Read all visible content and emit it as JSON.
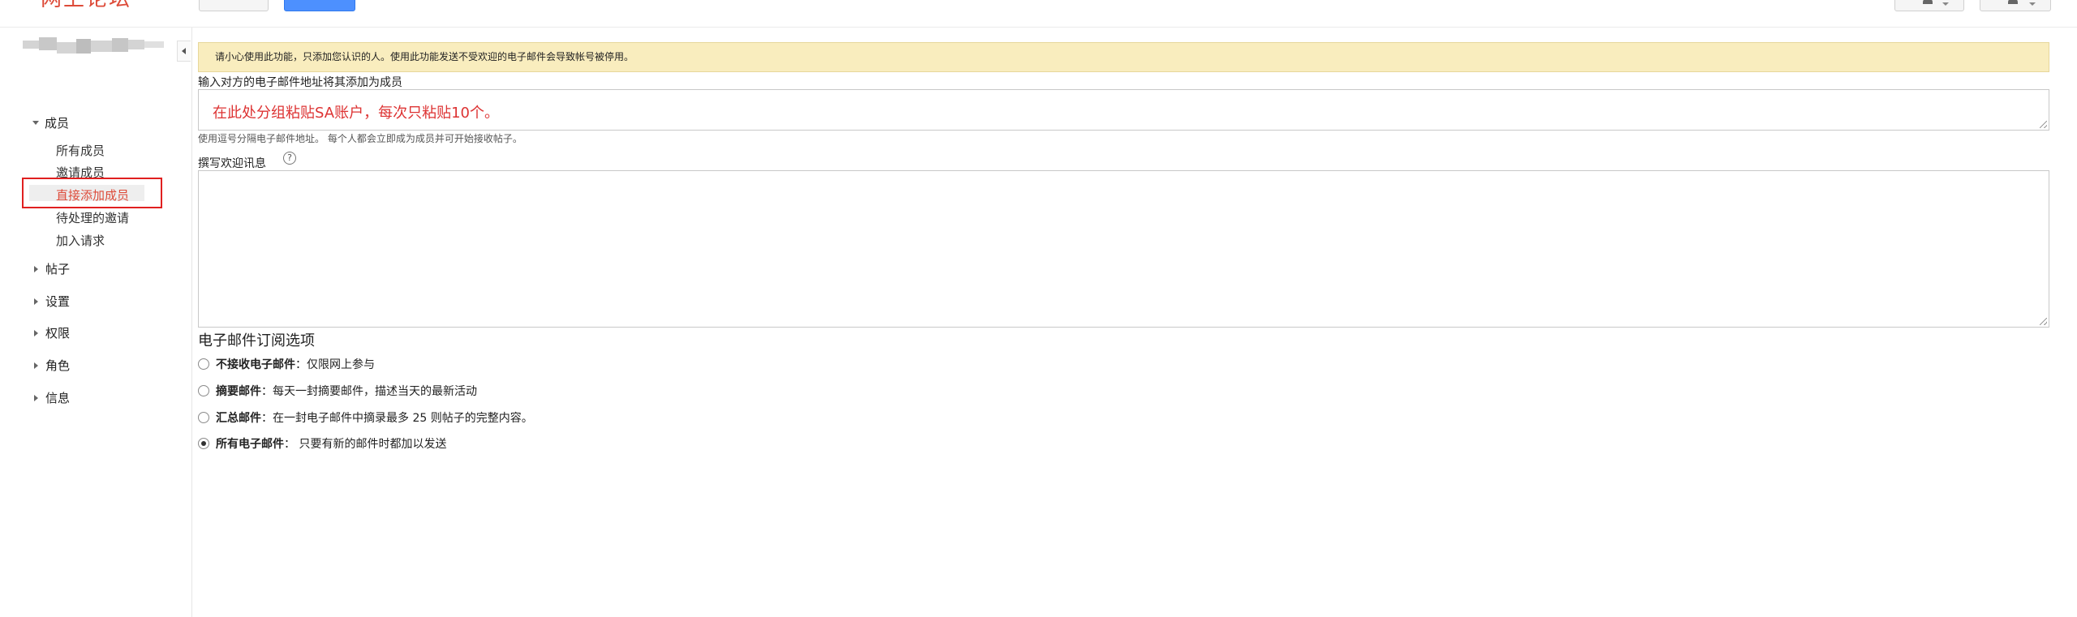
{
  "app": {
    "title": "网上论坛"
  },
  "sidebar": {
    "sections": [
      {
        "label": "成员",
        "expanded": true,
        "items": [
          "所有成员",
          "邀请成员",
          "直接添加成员",
          "待处理的邀请",
          "加入请求"
        ],
        "active_item": "直接添加成员"
      },
      {
        "label": "帖子",
        "expanded": false
      },
      {
        "label": "设置",
        "expanded": false
      },
      {
        "label": "权限",
        "expanded": false
      },
      {
        "label": "角色",
        "expanded": false
      },
      {
        "label": "信息",
        "expanded": false
      }
    ]
  },
  "main": {
    "alert": "请小心使用此功能，只添加您认识的人。使用此功能发送不受欢迎的电子邮件会导致帐号被停用。",
    "emails_label": "输入对方的电子邮件地址将其添加为成员",
    "emails_value": "在此处分组粘贴SA账户，每次只粘贴10个。",
    "emails_hint": "使用逗号分隔电子邮件地址。 每个人都会立即成为成员并可开始接收帖子。",
    "welcome_label": "撰写欢迎讯息",
    "help_glyph": "?",
    "subscription_heading": "电子邮件订阅选项",
    "options": [
      {
        "name": "不接收电子邮件",
        "desc": "：仅限网上参与",
        "checked": false
      },
      {
        "name": "摘要邮件",
        "desc": "：每天一封摘要邮件，描述当天的最新活动",
        "checked": false
      },
      {
        "name": "汇总邮件",
        "desc": "：在一封电子邮件中摘录最多 25 则帖子的完整内容。",
        "checked": false
      },
      {
        "name": "所有电子邮件",
        "desc": "： 只要有新的邮件时都加以发送",
        "checked": true
      }
    ]
  },
  "colors": {
    "accent_red": "#dd4b39",
    "alert_bg": "#f9edbe",
    "primary_blue": "#4d90fe"
  }
}
